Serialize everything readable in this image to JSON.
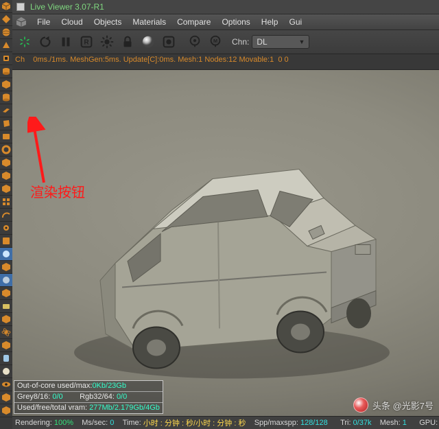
{
  "title": "Live Viewer 3.07-R1",
  "menu": [
    "File",
    "Cloud",
    "Objects",
    "Materials",
    "Compare",
    "Options",
    "Help",
    "Gui"
  ],
  "toolbar": {
    "render_icon": "aperture-icon",
    "chn_label": "Chn:",
    "chn_value": "DL"
  },
  "status_line": "Ch    0ms./1ms. MeshGen:5ms. Update[C]:0ms. Mesh:1 Nodes:12 Movable:1  0 0",
  "annotation": "渲染按钮",
  "statsbox": {
    "row1_label": "Out-of-core used/max:",
    "row1_val": "0Kb/23Gb",
    "row2_a_label": "Grey8/16: ",
    "row2_a_val": "0/0",
    "row2_b_label": "Rgb32/64: ",
    "row2_b_val": "0/0",
    "row3_label": "Used/free/total vram: ",
    "row3_val": "277Mb/2.179Gb/4Gb"
  },
  "bottombar": {
    "render_label": "Rendering: ",
    "render_val": "100%",
    "mssec_label": "Ms/sec: ",
    "mssec_val": "0",
    "time_label": "Time: ",
    "time_val": "小时 : 分钟 : 秒/小时 : 分钟 : 秒",
    "spp_label": "Spp/maxspp: ",
    "spp_val": "128/128",
    "tri_label": "Tri: ",
    "tri_val": "0/37k",
    "mesh_label": "Mesh: ",
    "mesh_val": "1",
    "gpu_label": "GPU:"
  },
  "watermark": "头条 @光影7号"
}
